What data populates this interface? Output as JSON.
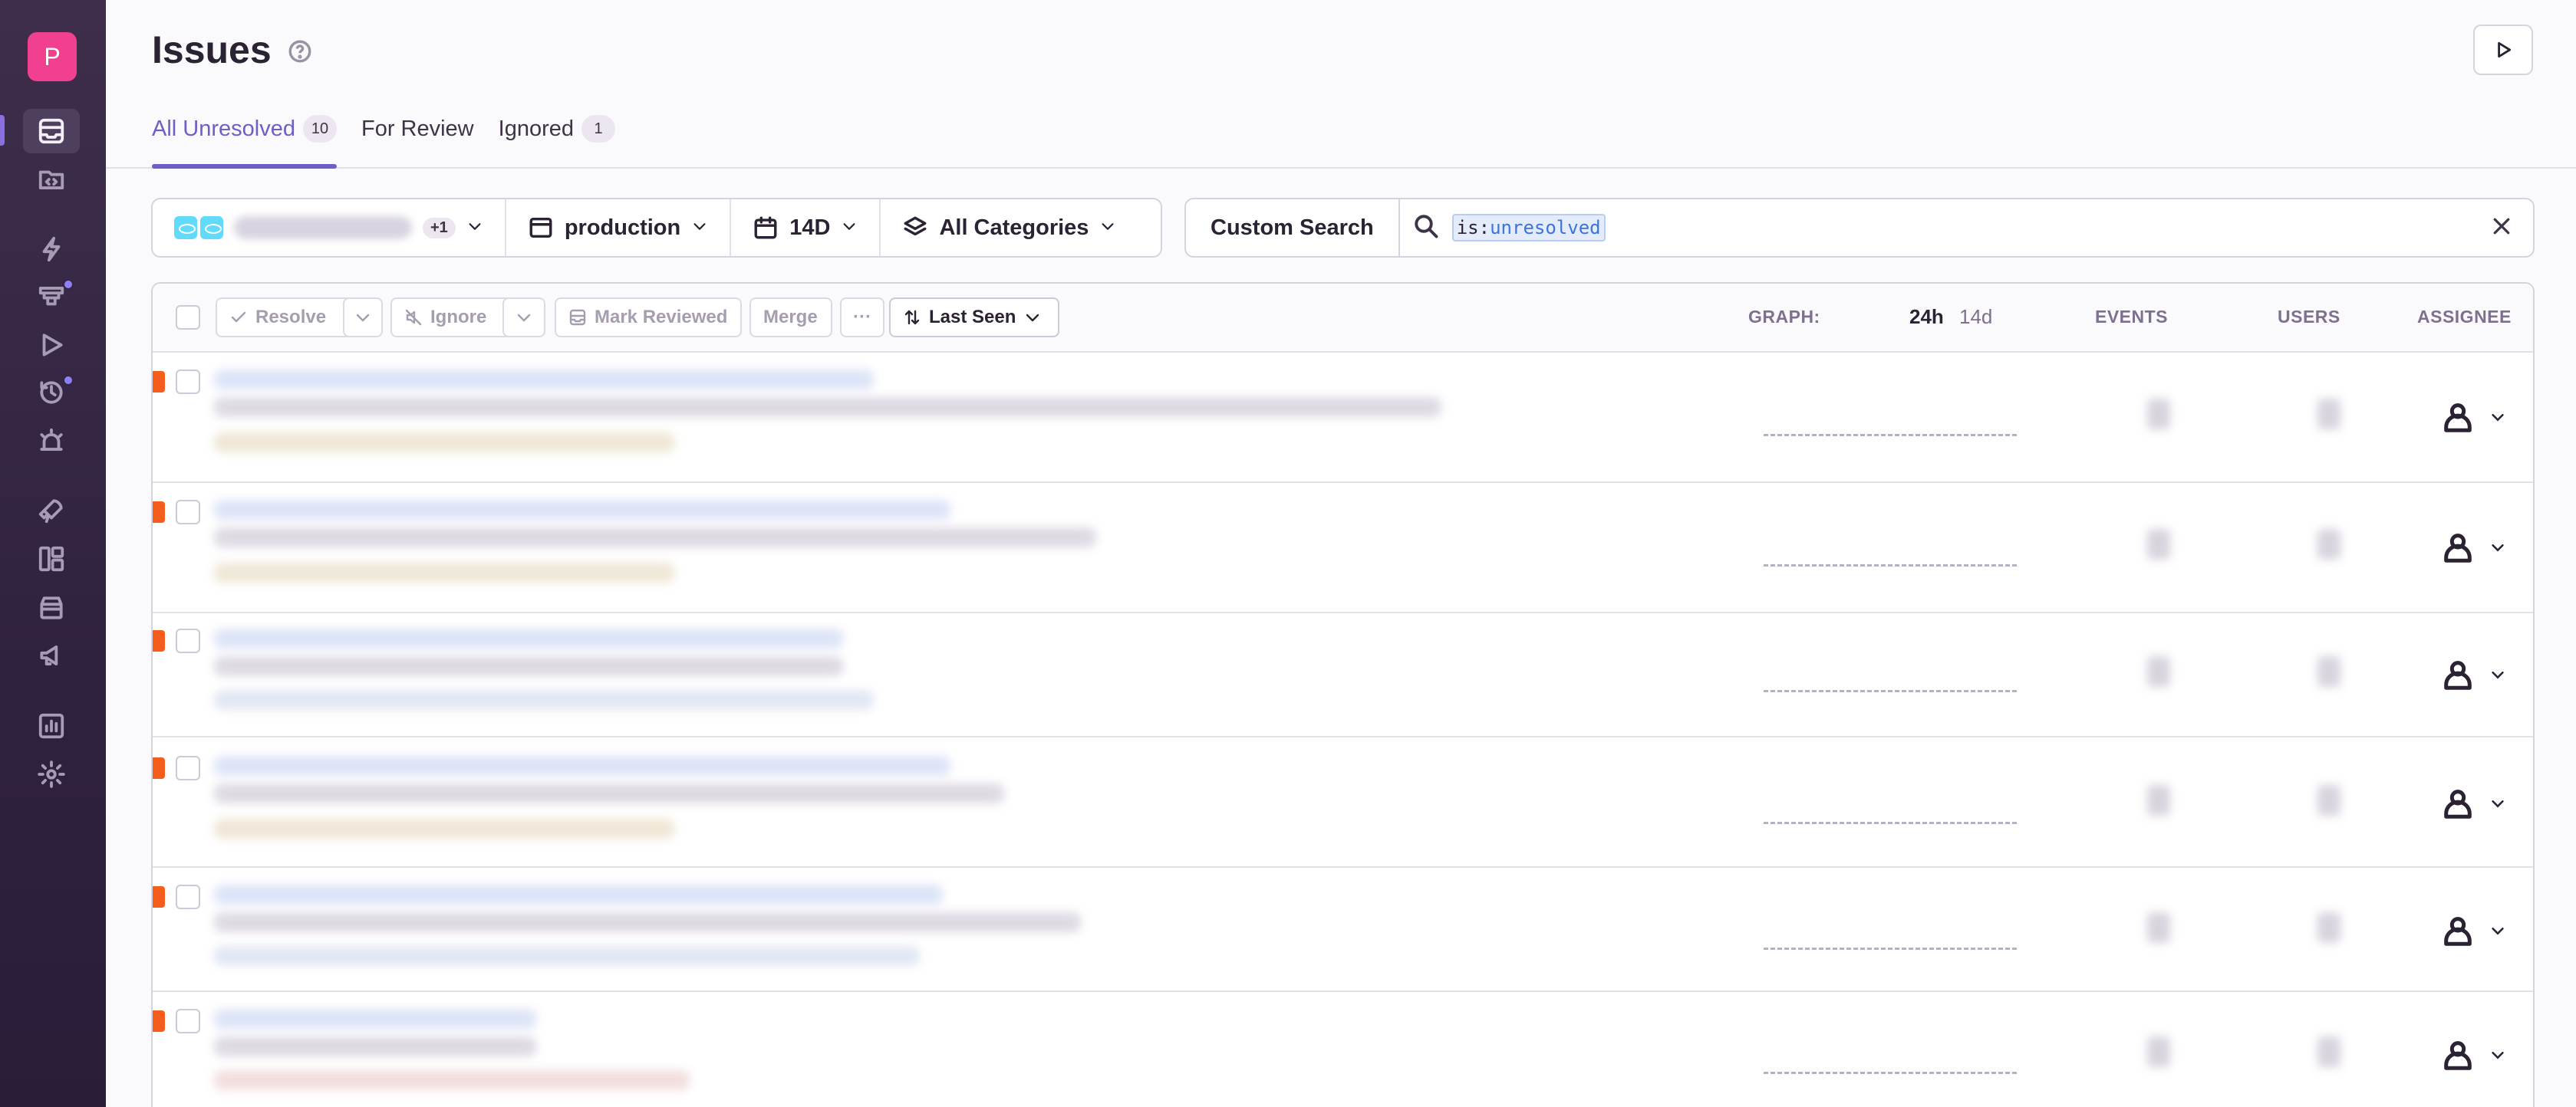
{
  "sidebar": {
    "org_initial": "P",
    "items": [
      {
        "name": "issues",
        "icon": "inbox-icon",
        "active": true
      },
      {
        "name": "projects",
        "icon": "code-folder-icon"
      },
      {
        "name": "performance",
        "icon": "lightning-icon"
      },
      {
        "name": "profiling",
        "icon": "stack-icon",
        "badge": true
      },
      {
        "name": "replays",
        "icon": "play-icon"
      },
      {
        "name": "crons",
        "icon": "clock-icon",
        "badge": true
      },
      {
        "name": "alerts",
        "icon": "siren-icon"
      },
      {
        "name": "releases",
        "icon": "rocket-icon"
      },
      {
        "name": "dashboards",
        "icon": "dashboard-icon"
      },
      {
        "name": "discover",
        "icon": "archive-icon"
      },
      {
        "name": "user-feedback",
        "icon": "megaphone-icon"
      },
      {
        "name": "stats",
        "icon": "bar-chart-icon"
      },
      {
        "name": "settings",
        "icon": "gear-icon"
      }
    ]
  },
  "header": {
    "title": "Issues",
    "tabs": [
      {
        "label": "All Unresolved",
        "count": "10",
        "active": true
      },
      {
        "label": "For Review",
        "count": ""
      },
      {
        "label": "Ignored",
        "count": "1"
      }
    ]
  },
  "filters": {
    "project_extra": "+1",
    "environment": "production",
    "date_range": "14D",
    "category": "All Categories",
    "custom_search": "Custom Search",
    "query_key": "is:",
    "query_value": "unresolved"
  },
  "toolbar": {
    "resolve": "Resolve",
    "ignore": "Ignore",
    "mark_reviewed": "Mark Reviewed",
    "merge": "Merge",
    "more": "···",
    "sort": "Last Seen",
    "graph_label": "GRAPH:",
    "period_24h": "24h",
    "period_14d": "14d",
    "events_label": "EVENTS",
    "users_label": "USERS",
    "assignee_label": "ASSIGNEE"
  },
  "colors": {
    "accent": "#6c5fc7",
    "level_error": "#f55d1c",
    "sidebar_bg": "#2f2240"
  }
}
